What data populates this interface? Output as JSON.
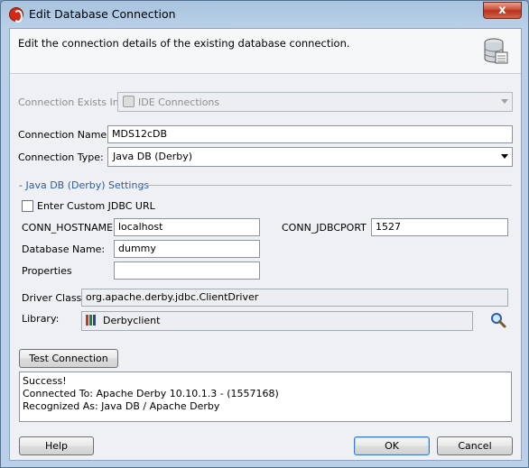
{
  "window": {
    "title": "Edit Database Connection",
    "close_glyph": "x"
  },
  "header": {
    "description": "Edit the connection details of the existing database connection."
  },
  "connection_exists_in": {
    "label": "Connection Exists In:",
    "value": "IDE Connections"
  },
  "connection_name": {
    "label": "Connection Name:",
    "value": "MDS12cDB"
  },
  "connection_type": {
    "label": "Connection Type:",
    "value": "Java DB (Derby)"
  },
  "section": {
    "title": "Java DB (Derby) Settings"
  },
  "custom_jdbc": {
    "label": "Enter Custom JDBC URL",
    "checked": false
  },
  "hostname": {
    "label": "CONN_HOSTNAME",
    "value": "localhost"
  },
  "jdbcport": {
    "label": "CONN_JDBCPORT",
    "value": "1527"
  },
  "database_name": {
    "label": "Database Name:",
    "value": "dummy"
  },
  "properties": {
    "label": "Properties",
    "value": ""
  },
  "driver_class": {
    "label": "Driver Class:",
    "value": "org.apache.derby.jdbc.ClientDriver"
  },
  "library": {
    "label": "Library:",
    "value": "Derbyclient"
  },
  "buttons": {
    "test": "Test Connection",
    "help": "Help",
    "ok": "OK",
    "cancel": "Cancel"
  },
  "results": [
    "Success!",
    "Connected To: Apache Derby 10.10.1.3 - (1557168)",
    "Recognized As: Java DB / Apache Derby"
  ]
}
